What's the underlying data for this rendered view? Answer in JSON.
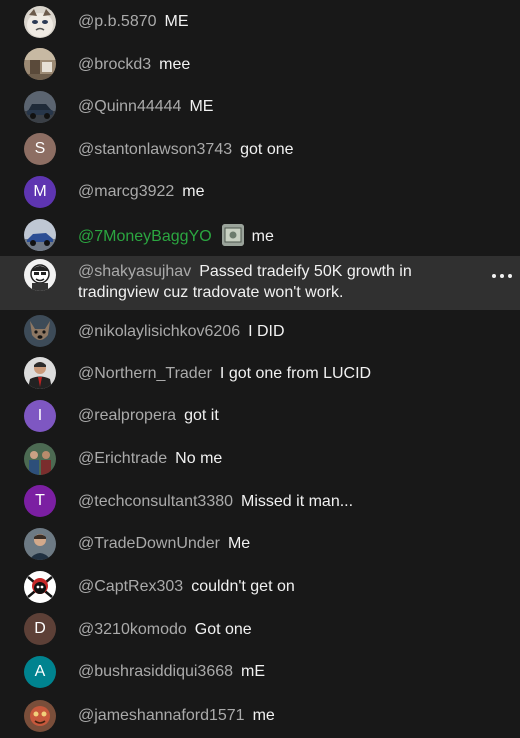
{
  "messages": [
    {
      "author": "@p.b.5870",
      "text": "ME",
      "avatar": "grumpy-cat-photo",
      "initial": ""
    },
    {
      "author": "@brockd3",
      "text": "mee",
      "avatar": "room-photo",
      "initial": ""
    },
    {
      "author": "@Quinn44444",
      "text": "ME",
      "avatar": "car-photo",
      "initial": ""
    },
    {
      "author": "@stantonlawson3743",
      "text": "got one",
      "avatar": "letter",
      "initial": "S",
      "color": "#8d6e63"
    },
    {
      "author": "@marcg3922",
      "text": "me",
      "avatar": "letter",
      "initial": "M",
      "color": "#5e35b1"
    },
    {
      "author": "@7MoneyBaggYO",
      "text": "me",
      "avatar": "sports-car-photo",
      "initial": "",
      "verified": true
    },
    {
      "author": "@shakyasujhav",
      "text": "Passed tradeify 50K growth in tradingview cuz tradovate won't work.",
      "avatar": "cartoon-face",
      "initial": "",
      "highlighted": true
    },
    {
      "author": "@nikolaylisichkov6206",
      "text": "I DID",
      "avatar": "dog-photo",
      "initial": ""
    },
    {
      "author": "@Northern_Trader",
      "text": "I got one from LUCID",
      "avatar": "man-suit-photo",
      "initial": ""
    },
    {
      "author": "@realpropera",
      "text": "got it",
      "avatar": "letter",
      "initial": "I",
      "color": "#7e57c2"
    },
    {
      "author": "@Erichtrade",
      "text": "No me",
      "avatar": "group-photo",
      "initial": ""
    },
    {
      "author": "@techconsultant3380",
      "text": "Missed it man...",
      "avatar": "letter",
      "initial": "T",
      "color": "#7b1fa2"
    },
    {
      "author": "@TradeDownUnder",
      "text": "Me",
      "avatar": "man-photo",
      "initial": ""
    },
    {
      "author": "@CaptRex303",
      "text": "couldn't get on",
      "avatar": "pirate-skull",
      "initial": ""
    },
    {
      "author": "@3210komodo",
      "text": "Got one",
      "avatar": "letter",
      "initial": "D",
      "color": "#5d4037"
    },
    {
      "author": "@bushrasiddiqui3668",
      "text": "mE",
      "avatar": "letter",
      "initial": "A",
      "color": "#00838f"
    },
    {
      "author": "@jameshannaford1571",
      "text": "me",
      "avatar": "face-photo",
      "initial": ""
    }
  ],
  "icons": {
    "more": "more-vert-icon",
    "verified_badge": "member-badge-icon"
  }
}
